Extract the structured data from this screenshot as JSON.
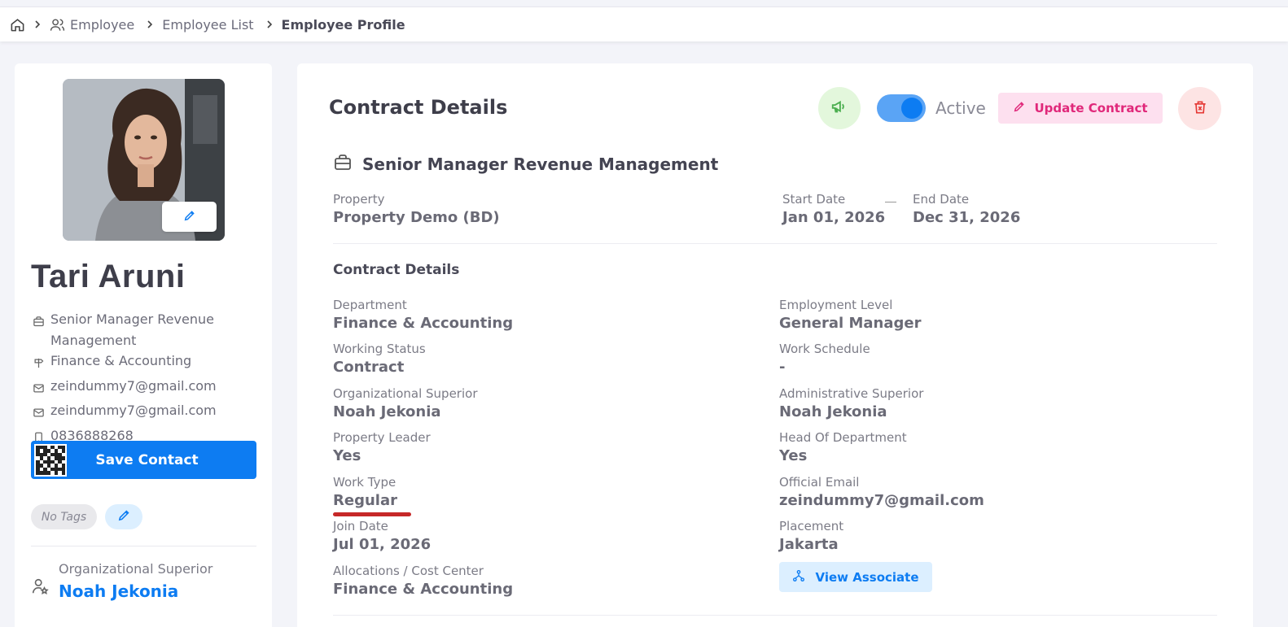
{
  "breadcrumb": {
    "items": [
      "Employee",
      "Employee List"
    ],
    "current": "Employee Profile"
  },
  "profile": {
    "name": "Tari Aruni",
    "position": "Senior Manager Revenue Management",
    "department": "Finance & Accounting",
    "email_1": "zeindummy7@gmail.com",
    "email_2": "zeindummy7@gmail.com",
    "phone": "0836888268",
    "save_contact_label": "Save Contact",
    "tags_placeholder": "No Tags",
    "superior_label": "Organizational Superior",
    "superior_name": "Noah Jekonia"
  },
  "contract": {
    "title": "Contract Details",
    "status_label": "Active",
    "update_label": "Update Contract",
    "position_title": "Senior Manager Revenue Management",
    "property_label": "Property",
    "property_value": "Property Demo (BD)",
    "start_label": "Start Date",
    "start_value": "Jan 01, 2026",
    "end_label": "End Date",
    "end_value": "Dec 31, 2026",
    "section_title": "Contract Details",
    "fields_left": [
      {
        "label": "Department",
        "value": "Finance & Accounting"
      },
      {
        "label": "Working Status",
        "value": "Contract"
      },
      {
        "label": "Organizational Superior",
        "value": "Noah Jekonia"
      },
      {
        "label": "Property Leader",
        "value": "Yes"
      },
      {
        "label": "Work Type",
        "value": "Regular"
      },
      {
        "label": "Join Date",
        "value": "Jul 01, 2026"
      },
      {
        "label": "Allocations / Cost Center",
        "value": "Finance & Accounting"
      }
    ],
    "fields_right": [
      {
        "label": "Employment Level",
        "value": "General Manager"
      },
      {
        "label": "Work Schedule",
        "value": "-"
      },
      {
        "label": "Administrative Superior",
        "value": "Noah Jekonia"
      },
      {
        "label": "Head Of Department",
        "value": "Yes"
      },
      {
        "label": "Official Email",
        "value": "zeindummy7@gmail.com"
      },
      {
        "label": "Placement",
        "value": "Jakarta"
      }
    ],
    "view_associate_label": "View Associate"
  },
  "colors": {
    "primary": "#0d7cf2",
    "pink": "#e0287a",
    "danger": "#e53935",
    "success": "#4caf50"
  },
  "icons": [
    "home-icon",
    "users-icon",
    "chevron-right-icon",
    "pencil-icon",
    "briefcase-icon",
    "signpost-icon",
    "mail-icon",
    "phone-icon",
    "qr-code-icon",
    "user-star-icon",
    "megaphone-icon",
    "trash-icon",
    "hierarchy-icon"
  ]
}
